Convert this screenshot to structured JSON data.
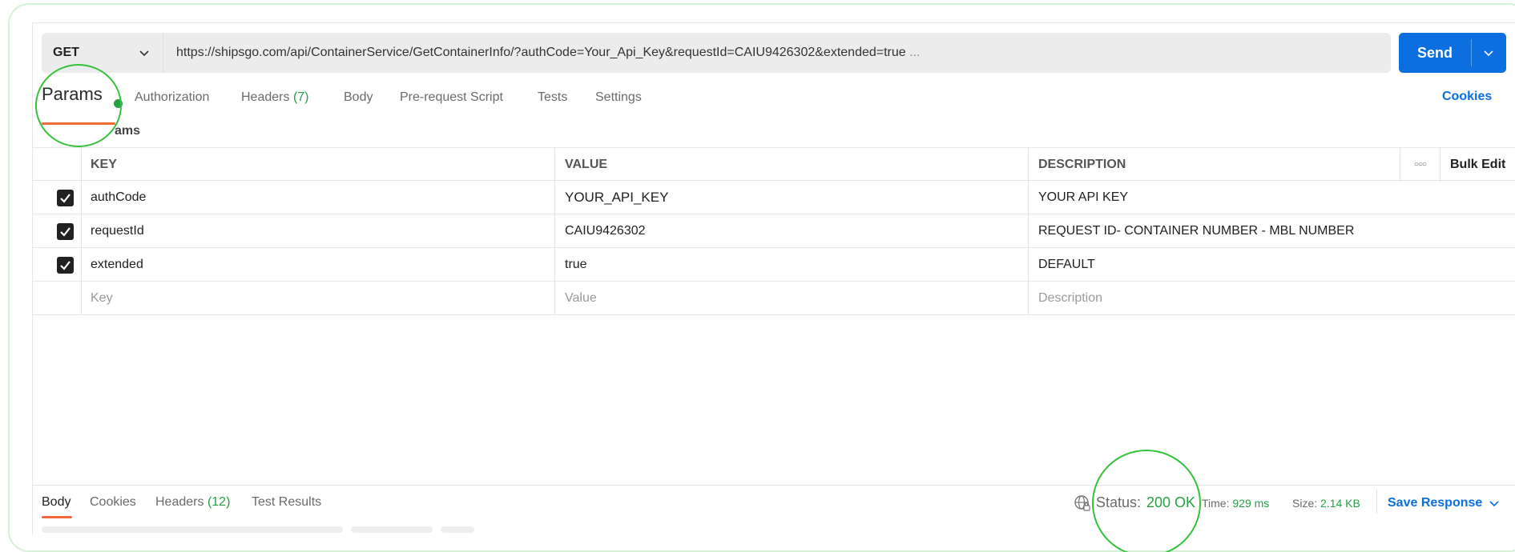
{
  "request": {
    "method": "GET",
    "url": "https://shipsgo.com/api/ContainerService/GetContainerInfo/?authCode=Your_Api_Key&requestId=CAIU9426302&extended=true",
    "url_more": "...",
    "send_label": "Send"
  },
  "tabs": {
    "params": "Params",
    "authorization": "Authorization",
    "headers": "Headers",
    "headers_count": "(7)",
    "body": "Body",
    "prerequest": "Pre-request Script",
    "tests": "Tests",
    "settings": "Settings",
    "cookies": "Cookies"
  },
  "query_params_label": "ams",
  "table": {
    "headers": {
      "key": "KEY",
      "value": "VALUE",
      "description": "DESCRIPTION",
      "bulk_edit": "Bulk Edit"
    },
    "rows": [
      {
        "checked": true,
        "key": "authCode",
        "value": "YOUR_API_KEY",
        "description": "YOUR API KEY"
      },
      {
        "checked": true,
        "key": "requestId",
        "value": "CAIU9426302",
        "description": "REQUEST ID- CONTAINER NUMBER - MBL NUMBER"
      },
      {
        "checked": true,
        "key": "extended",
        "value": "true",
        "description": "DEFAULT"
      }
    ],
    "placeholders": {
      "key": "Key",
      "value": "Value",
      "description": "Description"
    }
  },
  "response": {
    "tabs": {
      "body": "Body",
      "cookies": "Cookies",
      "headers": "Headers",
      "headers_count": "(12)",
      "test_results": "Test Results"
    },
    "status_label": "Status:",
    "status_value": "200 OK",
    "time_label": "Time:",
    "time_value": "929 ms",
    "size_label": "Size:",
    "size_value": "2.14 KB",
    "save_label": "Save Response"
  },
  "colors": {
    "accent": "#0b6fe0",
    "success": "#26a045",
    "active_tab": "#ef6a3a",
    "highlight_ring": "#35c13a"
  },
  "icons": [
    "chevron-down-icon",
    "checkbox-checked-icon",
    "more-horizontal-icon",
    "globe-lock-icon"
  ]
}
